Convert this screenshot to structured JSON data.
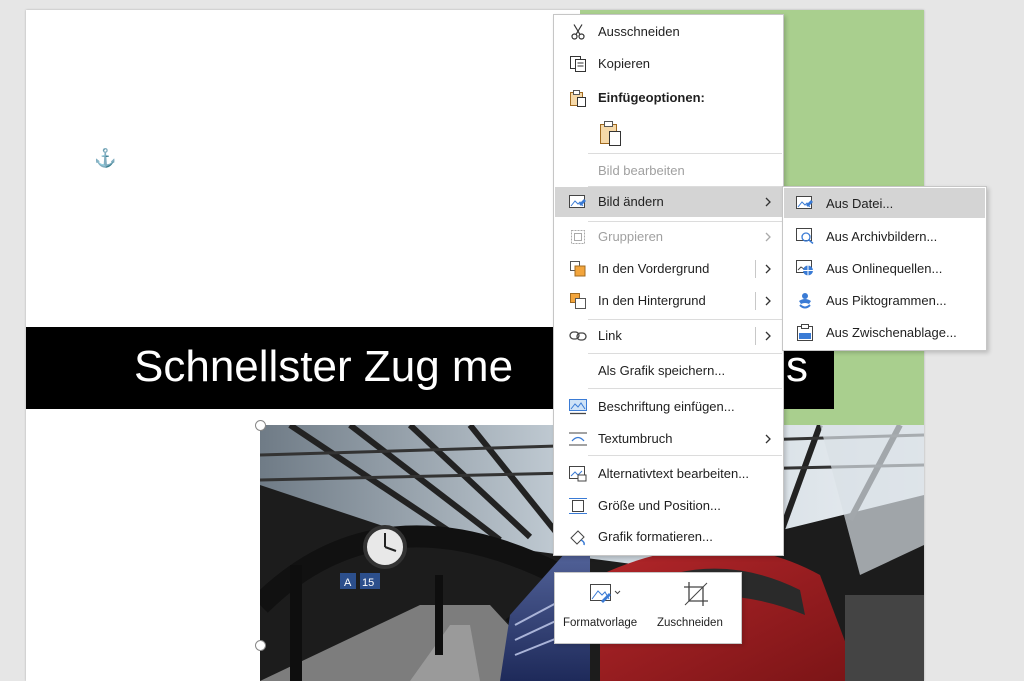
{
  "slide": {
    "title": "Schnellster Zug me",
    "title_tail": "s"
  },
  "context_menu": {
    "items": [
      {
        "label": "Ausschneiden",
        "icon": "scissors-icon",
        "enabled": true
      },
      {
        "label": "Kopieren",
        "icon": "copy-icon",
        "enabled": true
      },
      {
        "label": "Einfügeoptionen:",
        "icon": "paste-icon",
        "enabled": true
      },
      {
        "label": "Bild bearbeiten",
        "icon": "",
        "enabled": false
      },
      {
        "label": "Bild ändern",
        "icon": "change-picture-icon",
        "enabled": true,
        "submenu": true
      },
      {
        "label": "Gruppieren",
        "icon": "group-icon",
        "enabled": false,
        "submenu": true
      },
      {
        "label": "In den Vordergrund",
        "icon": "bring-forward-icon",
        "enabled": true,
        "submenu": true
      },
      {
        "label": "In den Hintergrund",
        "icon": "send-backward-icon",
        "enabled": true,
        "submenu": true
      },
      {
        "label": "Link",
        "icon": "link-icon",
        "enabled": true,
        "submenu": true
      },
      {
        "label": "Als Grafik speichern...",
        "icon": "",
        "enabled": true
      },
      {
        "label": "Beschriftung einfügen...",
        "icon": "insert-caption-icon",
        "enabled": true
      },
      {
        "label": "Textumbruch",
        "icon": "wrap-text-icon",
        "enabled": true,
        "submenu": true
      },
      {
        "label": "Alternativtext bearbeiten...",
        "icon": "alt-text-icon",
        "enabled": true
      },
      {
        "label": "Größe und Position...",
        "icon": "size-position-icon",
        "enabled": true
      },
      {
        "label": "Grafik formatieren...",
        "icon": "format-picture-icon",
        "enabled": true
      }
    ]
  },
  "submenu": {
    "items": [
      {
        "label": "Aus Datei...",
        "icon": "from-file-icon"
      },
      {
        "label": "Aus Archivbildern...",
        "icon": "stock-images-icon"
      },
      {
        "label": "Aus Onlinequellen...",
        "icon": "online-pictures-icon"
      },
      {
        "label": "Aus Piktogrammen...",
        "icon": "icons-icon"
      },
      {
        "label": "Aus Zwischenablage...",
        "icon": "clipboard-icon"
      }
    ]
  },
  "mini_toolbar": {
    "style_label": "Formatvorlage",
    "crop_label": "Zuschneiden"
  },
  "colors": {
    "accent_green": "#a9cf8e",
    "title_bg": "#000000",
    "hover": "#d4d4d4"
  }
}
